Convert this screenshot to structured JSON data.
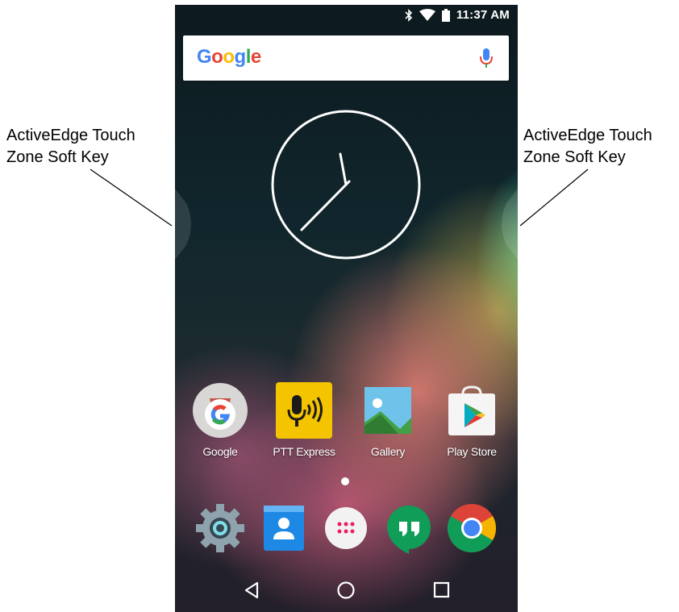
{
  "callouts": {
    "left": {
      "line1": "ActiveEdge Touch",
      "line2": "Zone Soft Key"
    },
    "right": {
      "line1": "ActiveEdge Touch",
      "line2": "Zone Soft Key"
    }
  },
  "status_bar": {
    "icons": [
      "bluetooth-icon",
      "wifi-icon",
      "battery-icon"
    ],
    "time": "11:37 AM"
  },
  "search_bar": {
    "logo_letters": [
      {
        "ch": "G",
        "color": "#4285F4"
      },
      {
        "ch": "o",
        "color": "#EA4335"
      },
      {
        "ch": "o",
        "color": "#FBBC05"
      },
      {
        "ch": "g",
        "color": "#4285F4"
      },
      {
        "ch": "l",
        "color": "#34A853"
      },
      {
        "ch": "e",
        "color": "#EA4335"
      }
    ],
    "mic_icon": "microphone-icon"
  },
  "clock_widget": {
    "type": "analog",
    "time": "11:37"
  },
  "apps": [
    {
      "label": "Google",
      "icon": "google-icon"
    },
    {
      "label": "PTT Express",
      "icon": "ptt-express-icon"
    },
    {
      "label": "Gallery",
      "icon": "gallery-icon"
    },
    {
      "label": "Play Store",
      "icon": "play-store-icon"
    }
  ],
  "dock": [
    {
      "icon": "settings-icon"
    },
    {
      "icon": "contacts-icon"
    },
    {
      "icon": "app-drawer-icon"
    },
    {
      "icon": "hangouts-icon"
    },
    {
      "icon": "chrome-icon"
    }
  ],
  "nav_bar": [
    "back-icon",
    "home-icon",
    "recents-icon"
  ],
  "colors": {
    "ptt_yellow": "#F5C400",
    "hangouts_green": "#0F9D58",
    "contacts_blue": "#1E88E5"
  }
}
